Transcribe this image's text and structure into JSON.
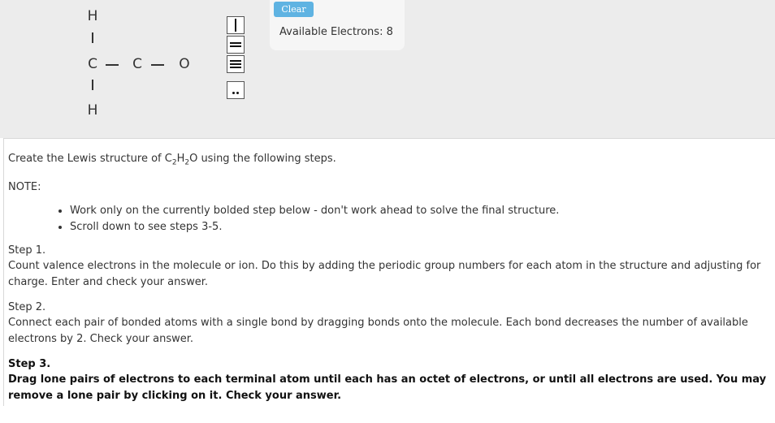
{
  "canvas": {
    "atoms": {
      "h_top": "H",
      "c_left": "C",
      "c_mid": "C",
      "o": "O",
      "h_bottom": "H"
    }
  },
  "toolbar": {
    "tools": [
      "single-bond",
      "double-bond",
      "triple-bond",
      "lone-pair"
    ]
  },
  "controls": {
    "clear_label": "Clear",
    "available_electrons": "Available Electrons: 8"
  },
  "instructions": {
    "intro_pre": "Create the Lewis structure of C",
    "intro_sub1": "2",
    "intro_mid": "H",
    "intro_sub2": "2",
    "intro_post": "O using the following steps.",
    "note_label": "NOTE:",
    "notes": [
      "Work only on the currently bolded step below - don't work ahead to solve the final structure.",
      "Scroll down to see steps 3-5."
    ],
    "steps": [
      {
        "title": "Step 1.",
        "text": "Count valence electrons in the molecule or ion. Do this by adding the periodic group numbers for each atom in the structure and adjusting for charge. Enter and check your answer."
      },
      {
        "title": "Step 2.",
        "text": "Connect each pair of bonded atoms with a single bond by dragging bonds onto the molecule. Each bond decreases the number of available electrons by 2. Check your answer."
      },
      {
        "title": "Step 3.",
        "text": "Drag lone pairs of electrons to each terminal atom until each has an octet of electrons, or until all electrons are used. You may remove a lone pair by clicking on it. Check your answer."
      }
    ]
  },
  "colors": {
    "clear_button": "#5fb3e2",
    "top_background": "#ececec"
  }
}
